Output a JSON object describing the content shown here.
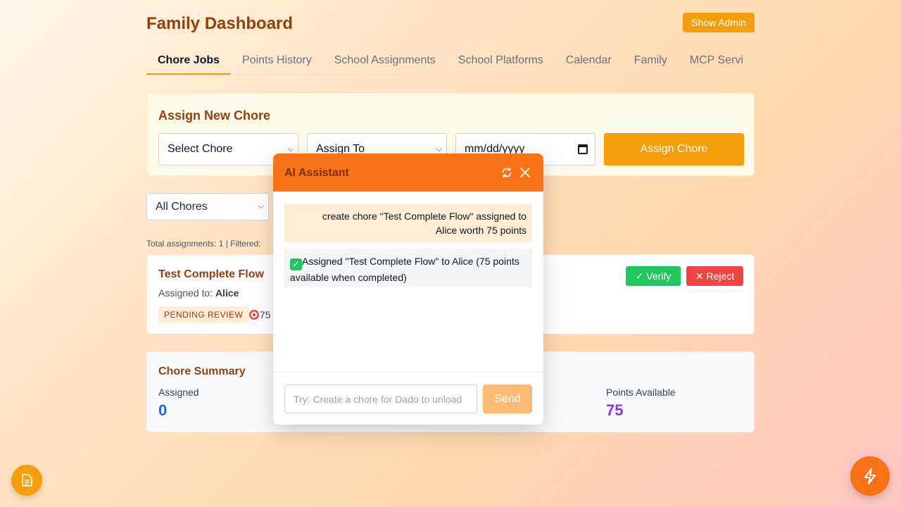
{
  "header": {
    "title": "Family Dashboard",
    "admin_button": "Show Admin"
  },
  "tabs": [
    {
      "label": "Chore Jobs",
      "active": true
    },
    {
      "label": "Points History"
    },
    {
      "label": "School Assignments"
    },
    {
      "label": "School Platforms"
    },
    {
      "label": "Calendar"
    },
    {
      "label": "Family"
    },
    {
      "label": "MCP Servi"
    }
  ],
  "assign": {
    "title": "Assign New Chore",
    "chore_select": "Select Chore",
    "assignee_select": "Assign To",
    "date_placeholder": "mm/dd/yyyy",
    "submit": "Assign Chore"
  },
  "filter": {
    "selected": "All Chores",
    "totals": "Total assignments: 1 | Filtered:"
  },
  "chore": {
    "title": "Test Complete Flow",
    "assigned_prefix": "Assigned to: ",
    "assignee": "Alice",
    "status": "PENDING REVIEW",
    "points": "75",
    "verify": "✓ Verify",
    "reject": "✕ Reject"
  },
  "summary": {
    "title": "Chore Summary",
    "assigned_label": "Assigned",
    "assigned_value": "0",
    "points_label": "Points Available",
    "points_value": "75"
  },
  "ai": {
    "title": "AI Assistant",
    "user_message": "create chore \"Test Complete Flow\" assigned to Alice worth 75 points",
    "bot_message": "Assigned \"Test Complete Flow\" to Alice (75 points available when completed)",
    "input_placeholder": "Try: Create a chore for Dado to unload",
    "send": "Send"
  },
  "colors": {
    "accent": "#f59e0b",
    "ai_header": "#f97316",
    "title": "#92400e",
    "assigned_value": "#2563eb",
    "points_value": "#9333ea",
    "verify": "#22c55e",
    "reject": "#ef4444"
  },
  "icons": {
    "refresh": "refresh-icon",
    "close": "close-icon",
    "calendar": "calendar-icon",
    "document": "document-icon",
    "lightning": "lightning-icon",
    "target": "target-icon",
    "check": "check-icon"
  }
}
